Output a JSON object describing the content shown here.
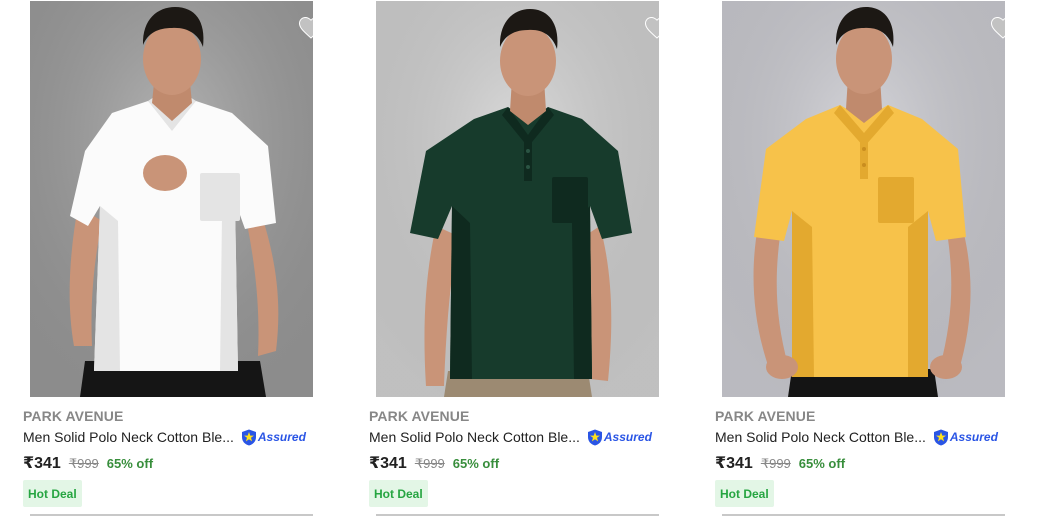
{
  "products": [
    {
      "brand": "PARK AVENUE",
      "title": "Men Solid Polo Neck Cotton Ble...",
      "assured_label": "Assured",
      "price": "₹341",
      "mrp": "₹999",
      "discount": "65% off",
      "badge": "Hot Deal",
      "shirt_color": "#fbfbfb",
      "shirt_shade": "#e4e4e4",
      "bg_color": "#9c9c9c",
      "pants_color": "#151515"
    },
    {
      "brand": "PARK AVENUE",
      "title": "Men Solid Polo Neck Cotton Ble...",
      "assured_label": "Assured",
      "price": "₹341",
      "mrp": "₹999",
      "discount": "65% off",
      "badge": "Hot Deal",
      "shirt_color": "#173b2c",
      "shirt_shade": "#0f2a1f",
      "bg_color": "#cfcfcf",
      "pants_color": "#9c8a72"
    },
    {
      "brand": "PARK AVENUE",
      "title": "Men Solid Polo Neck Cotton Ble...",
      "assured_label": "Assured",
      "price": "₹341",
      "mrp": "₹999",
      "discount": "65% off",
      "badge": "Hot Deal",
      "shirt_color": "#f7c24a",
      "shirt_shade": "#e3a92f",
      "bg_color": "#c9c9cf",
      "pants_color": "#141414"
    }
  ],
  "colors": {
    "brand_text": "#878787",
    "title_text": "#212121",
    "assured_blue": "#2a55e5",
    "discount_green": "#388e3c",
    "badge_bg": "#e3f6e6",
    "badge_text": "#26a541",
    "wishlist_heart": "#c2c2c2"
  },
  "icons": {
    "wishlist": "heart-icon",
    "assured": "assured-shield-icon"
  }
}
